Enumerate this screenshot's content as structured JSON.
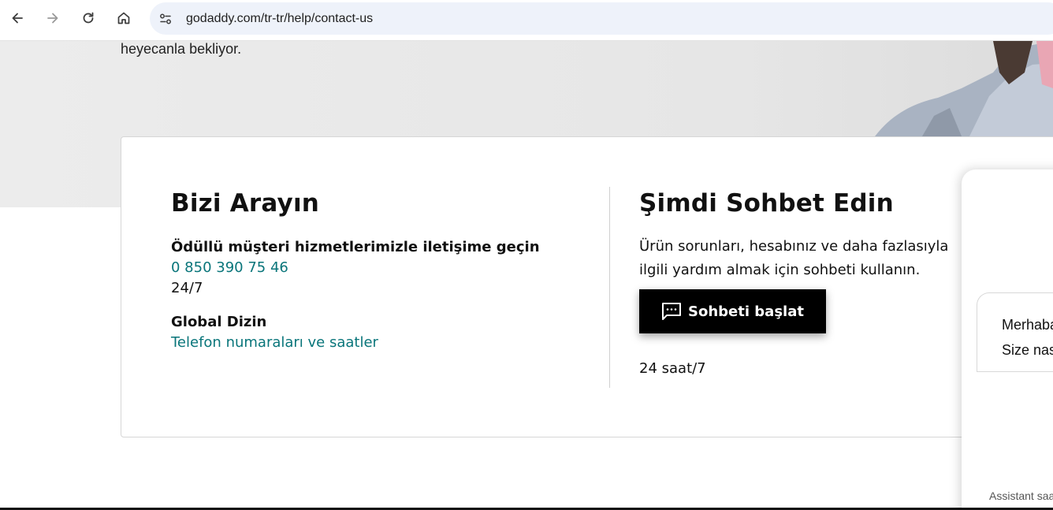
{
  "browser": {
    "url": "godaddy.com/tr-tr/help/contact-us"
  },
  "hero": {
    "text": "heyecanla bekliyor."
  },
  "call": {
    "title": "Bizi Arayın",
    "subtitle": "Ödüllü müşteri hizmetlerimizle iletişime geçin",
    "phone": "0 850 390 75 46",
    "hours": "24/7",
    "directory_title": "Global Dizin",
    "directory_link": "Telefon numaraları ve saatler"
  },
  "chat": {
    "title": "Şimdi Sohbet Edin",
    "description": "Ürün sorunları, hesabınız ve daha fazlasıyla ilgili yardım almak için sohbeti kullanın.",
    "button_label": "Sohbeti başlat",
    "hours": "24 saat/7"
  },
  "chat_widget": {
    "greeting_line1": "Merhaba",
    "greeting_line2": "Size nasıl",
    "assistant_note": "Assistant saat"
  },
  "colors": {
    "link": "#09757a",
    "button_bg": "#000000",
    "hero_bg": "#e8e8e8"
  }
}
